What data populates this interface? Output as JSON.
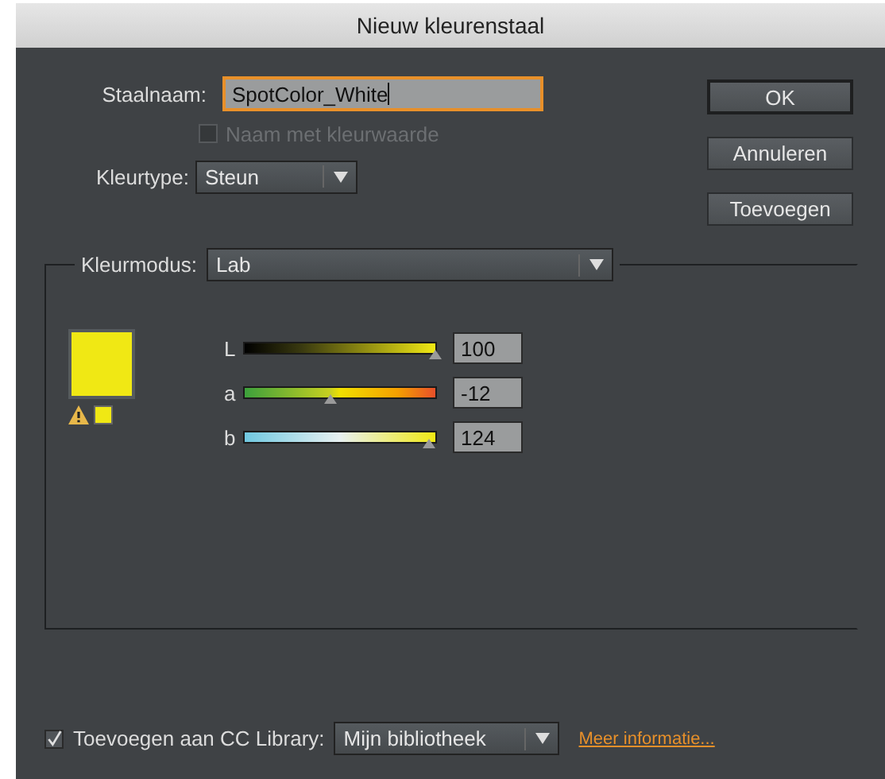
{
  "window": {
    "title": "Nieuw kleurenstaal"
  },
  "name_field": {
    "label": "Staalnaam:",
    "value": "SpotColor_White",
    "focused": true
  },
  "name_with_value": {
    "label": "Naam met kleurwaarde",
    "checked": false,
    "disabled": true
  },
  "color_type": {
    "label": "Kleurtype:",
    "value": "Steun"
  },
  "buttons": [
    {
      "label": "OK",
      "default": true
    },
    {
      "label": "Annuleren",
      "default": false
    },
    {
      "label": "Toevoegen",
      "default": false
    }
  ],
  "color_mode": {
    "label": "Kleurmodus:",
    "value": "Lab"
  },
  "preview": {
    "color": "#f0e814",
    "gamut_warning": true
  },
  "channels": [
    {
      "name": "L",
      "kind": "lightness",
      "level": 1.0,
      "value": "100"
    },
    {
      "name": "a",
      "kind": "green-red",
      "level": 0.45,
      "value": "-12"
    },
    {
      "name": "b",
      "kind": "blue-yellow",
      "level": 0.97,
      "value": "124"
    }
  ],
  "library": {
    "checked": true,
    "label": "Toevoegen aan CC Library:",
    "value": "Mijn bibliotheek",
    "link": "Meer informatie..."
  }
}
